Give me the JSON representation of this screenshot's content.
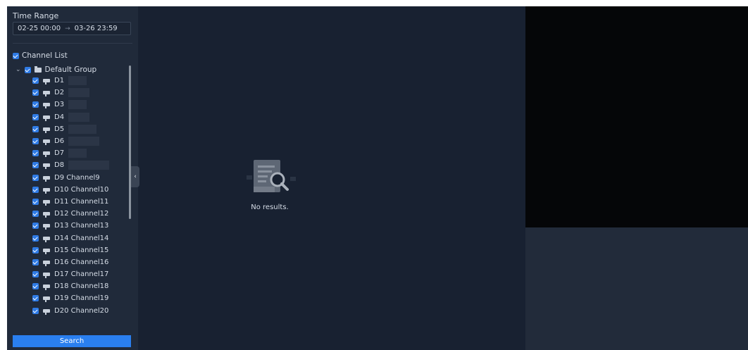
{
  "time_range": {
    "label": "Time Range",
    "start": "02-25 00:00",
    "arrow": "→",
    "end": "03-26 23:59"
  },
  "channel_list": {
    "label": "Channel List",
    "group": "Default Group",
    "channels": [
      {
        "id": "D1",
        "name": ""
      },
      {
        "id": "D2",
        "name": ""
      },
      {
        "id": "D3",
        "name": ""
      },
      {
        "id": "D4",
        "name": ""
      },
      {
        "id": "D5",
        "name": ""
      },
      {
        "id": "D6",
        "name": ""
      },
      {
        "id": "D7",
        "name": ""
      },
      {
        "id": "D8",
        "name": ""
      },
      {
        "id": "D9",
        "name": "Channel9"
      },
      {
        "id": "D10",
        "name": "Channel10"
      },
      {
        "id": "D11",
        "name": "Channel11"
      },
      {
        "id": "D12",
        "name": "Channel12"
      },
      {
        "id": "D13",
        "name": "Channel13"
      },
      {
        "id": "D14",
        "name": "Channel14"
      },
      {
        "id": "D15",
        "name": "Channel15"
      },
      {
        "id": "D16",
        "name": "Channel16"
      },
      {
        "id": "D17",
        "name": "Channel17"
      },
      {
        "id": "D18",
        "name": "Channel18"
      },
      {
        "id": "D19",
        "name": "Channel19"
      },
      {
        "id": "D20",
        "name": "Channel20"
      }
    ]
  },
  "search_label": "Search",
  "results": {
    "empty_text": "No results."
  },
  "collapse_glyph": "‹",
  "colors": {
    "accent": "#2a7fef",
    "panel": "#202a3a",
    "background": "#182131"
  }
}
